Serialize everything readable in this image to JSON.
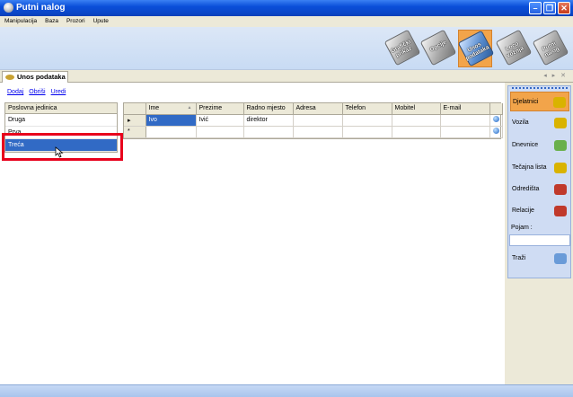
{
  "window": {
    "title": "Putni nalog"
  },
  "menu": [
    "Manipulacija",
    "Baza",
    "Prozori",
    "Upute"
  ],
  "toolbar": [
    {
      "label": "Grafički prikaz",
      "active": false
    },
    {
      "label": "Opcije",
      "active": false
    },
    {
      "label": "Unos podataka",
      "active": true
    },
    {
      "label": "Loco vožnja",
      "active": false
    },
    {
      "label": "Putni nalog",
      "active": false
    }
  ],
  "tab": {
    "label": "Unos podataka"
  },
  "actions": {
    "add": "Dodaj",
    "delete": "Obriši",
    "edit": "Uredi"
  },
  "units": {
    "header": "Poslovna jedinica",
    "items": [
      "Druga",
      "Prva",
      "Treća"
    ],
    "selected": "Treća"
  },
  "employees": {
    "columns": [
      "Ime",
      "Prezime",
      "Radno mjesto",
      "Adresa",
      "Telefon",
      "Mobitel",
      "E-mail"
    ],
    "rows": [
      {
        "marker": "▸",
        "cells": [
          "Ivo",
          "Ivić",
          "direktor",
          "",
          "",
          "",
          ""
        ]
      },
      {
        "marker": "*",
        "cells": [
          "",
          "",
          "",
          "",
          "",
          "",
          ""
        ]
      }
    ]
  },
  "sidebar": {
    "items": [
      {
        "label": "Djelatnici",
        "active": true,
        "icon": "worker-icon",
        "color": "#d9b300"
      },
      {
        "label": "Vozila",
        "active": false,
        "icon": "vehicle-icon",
        "color": "#d9b300"
      },
      {
        "label": "Dnevnice",
        "active": false,
        "icon": "money-icon",
        "color": "#6ab04c"
      },
      {
        "label": "Tečajna lista",
        "active": false,
        "icon": "exchange-icon",
        "color": "#d9b300"
      },
      {
        "label": "Odredišta",
        "active": false,
        "icon": "destination-icon",
        "color": "#c0392b"
      },
      {
        "label": "Relacije",
        "active": false,
        "icon": "route-icon",
        "color": "#c0392b"
      }
    ],
    "search_label": "Pojam :",
    "search_value": "",
    "search_button": "Traži"
  }
}
